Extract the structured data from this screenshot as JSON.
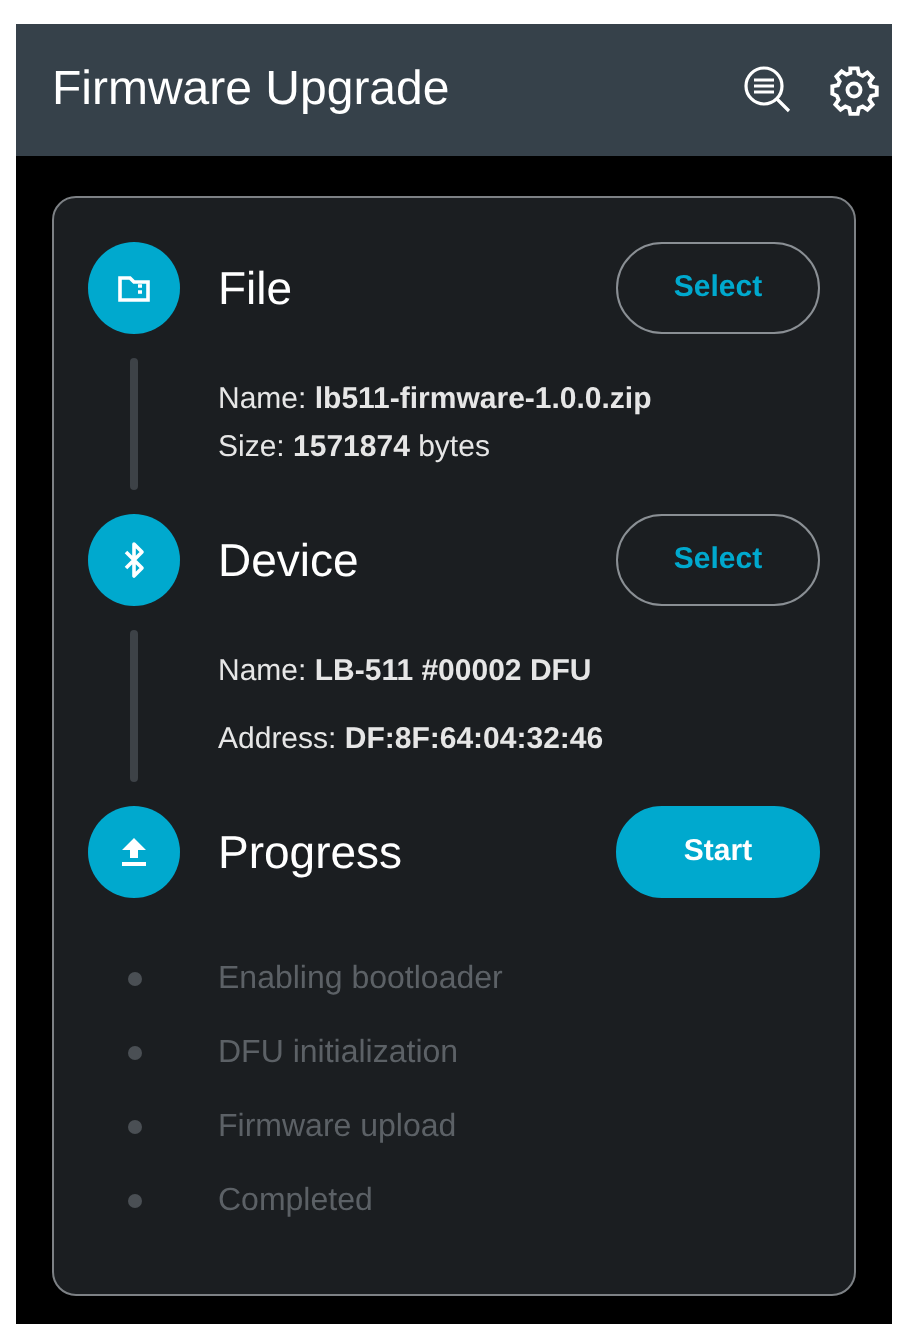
{
  "app_bar": {
    "title": "Firmware Upgrade"
  },
  "sections": [
    {
      "kind": "file",
      "title": "File",
      "button": {
        "label": "Select"
      },
      "details": [
        "Name: **lb511-firmware-1.0.0.zip**",
        "Size: **1571874** bytes"
      ]
    },
    {
      "kind": "device",
      "title": "Device",
      "button": {
        "label": "Select"
      },
      "details": [
        "Name: **LB-511 #00002 DFU**",
        "Address: **DF:8F:64:04:32:46**"
      ]
    },
    {
      "kind": "progress",
      "title": "Progress",
      "button": {
        "label": "Start"
      },
      "steps": [
        {
          "label": "Enabling bootloader",
          "done": false
        },
        {
          "label": "DFU initialization",
          "done": false
        },
        {
          "label": "Firmware upload",
          "done": false
        },
        {
          "label": "Completed",
          "done": false
        }
      ]
    }
  ]
}
